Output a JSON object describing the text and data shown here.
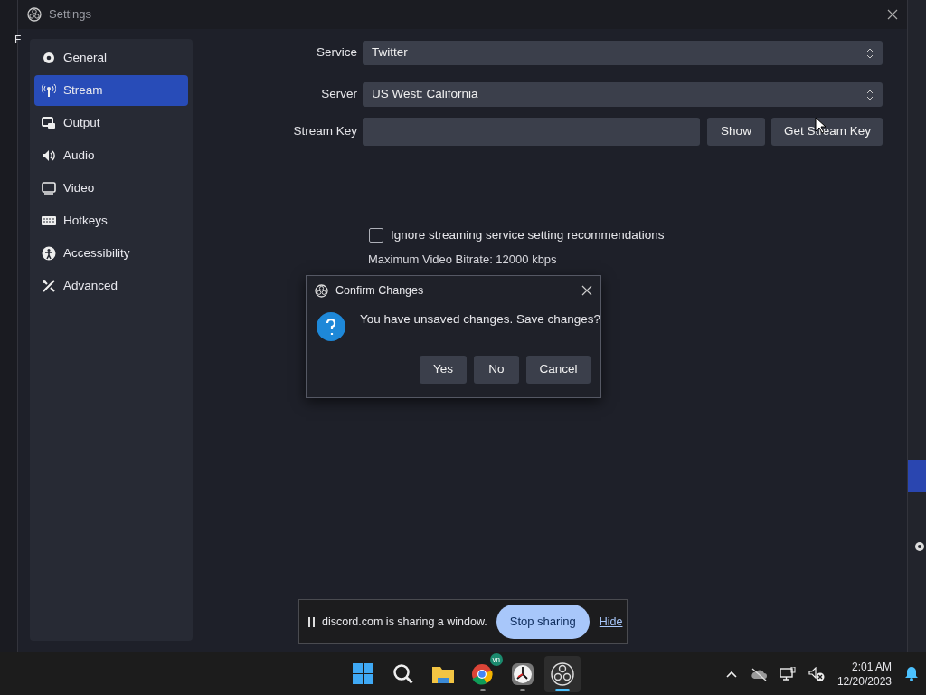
{
  "background_app": {
    "menu_fragment": "F"
  },
  "window": {
    "title": "Settings"
  },
  "sidebar": {
    "items": [
      {
        "label": "General",
        "selected": false
      },
      {
        "label": "Stream",
        "selected": true
      },
      {
        "label": "Output",
        "selected": false
      },
      {
        "label": "Audio",
        "selected": false
      },
      {
        "label": "Video",
        "selected": false
      },
      {
        "label": "Hotkeys",
        "selected": false
      },
      {
        "label": "Accessibility",
        "selected": false
      },
      {
        "label": "Advanced",
        "selected": false
      }
    ]
  },
  "stream": {
    "fields": [
      {
        "label": "Service",
        "value": "Twitter"
      },
      {
        "label": "Server",
        "value": "US West: California"
      }
    ],
    "stream_key": {
      "label": "Stream Key",
      "buttons": [
        "Show",
        "Get Stream Key"
      ]
    },
    "ignore_recommendations": {
      "label": "Ignore streaming service setting recommendations",
      "checked": false
    },
    "info": "Maximum Video Bitrate: 12000 kbps"
  },
  "dialog": {
    "title": "Confirm Changes",
    "message": "You have unsaved changes. Save changes?",
    "buttons": [
      "Yes",
      "No",
      "Cancel"
    ]
  },
  "share_bar": {
    "message": "discord.com is sharing a window.",
    "stop_button": "Stop sharing",
    "hide_link": "Hide"
  },
  "taskbar": {
    "apps": [
      {
        "kind": "start",
        "running": false,
        "selected": false
      },
      {
        "kind": "search",
        "running": false,
        "selected": false
      },
      {
        "kind": "folder",
        "running": false,
        "selected": false
      },
      {
        "kind": "browser",
        "running": true,
        "selected": false,
        "badge": "vn"
      },
      {
        "kind": "clock",
        "running": true,
        "selected": false
      },
      {
        "kind": "obs",
        "running": true,
        "selected": true
      }
    ],
    "time": "2:01 AM",
    "date": "12/20/2023"
  }
}
